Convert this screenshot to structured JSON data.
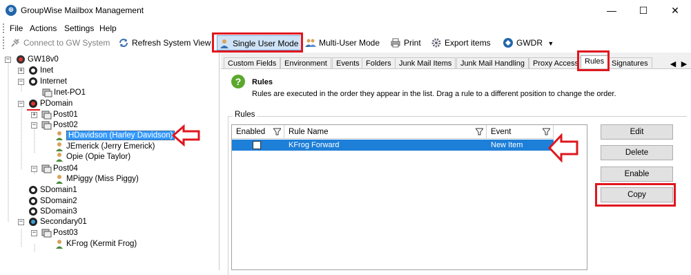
{
  "window": {
    "title": "GroupWise Mailbox Management",
    "minimize": "—",
    "maximize": "☐",
    "close": "✕"
  },
  "menu": [
    "File",
    "Actions",
    "Settings",
    "Help"
  ],
  "toolbar": {
    "connect": "Connect to GW System",
    "refresh": "Refresh System View",
    "single_user": "Single User Mode",
    "multi_user": "Multi-User Mode",
    "print": "Print",
    "export": "Export items",
    "gwdr": "GWDR"
  },
  "tree": {
    "root": "GW18v0",
    "inet": "Inet",
    "internet": "Internet",
    "inet_po1": "Inet-PO1",
    "pdomain": "PDomain",
    "post01": "Post01",
    "post02": "Post02",
    "hdavidson": "HDavidson (Harley Davidson)",
    "jemerick": "JEmerick (Jerry Emerick)",
    "opie": "Opie (Opie Taylor)",
    "post04": "Post04",
    "mpiggy": "MPiggy (Miss Piggy)",
    "sdomain1": "SDomain1",
    "sdomain2": "SDomain2",
    "sdomain3": "SDomain3",
    "secondary01": "Secondary01",
    "post03": "Post03",
    "kfrog": "KFrog (Kermit Frog)"
  },
  "tabs": [
    "Custom Fields",
    "Environment",
    "Events",
    "Folders",
    "Junk Mail Items",
    "Junk Mail Handling",
    "Proxy Access",
    "Rules",
    "Signatures"
  ],
  "panel": {
    "title": "Rules",
    "description": "Rules are executed in the order they appear in the list. Drag a rule to a different position to change the order.",
    "group_label": "Rules"
  },
  "grid": {
    "columns": [
      "Enabled",
      "Rule Name",
      "Event"
    ],
    "rows": [
      {
        "enabled": false,
        "rule_name": "KFrog Forward",
        "event": "New Item"
      }
    ]
  },
  "buttons": {
    "edit": "Edit",
    "delete": "Delete",
    "enable": "Enable",
    "copy": "Copy"
  },
  "colors": {
    "highlight": "#e0161e",
    "selection": "#1e7fd8"
  }
}
